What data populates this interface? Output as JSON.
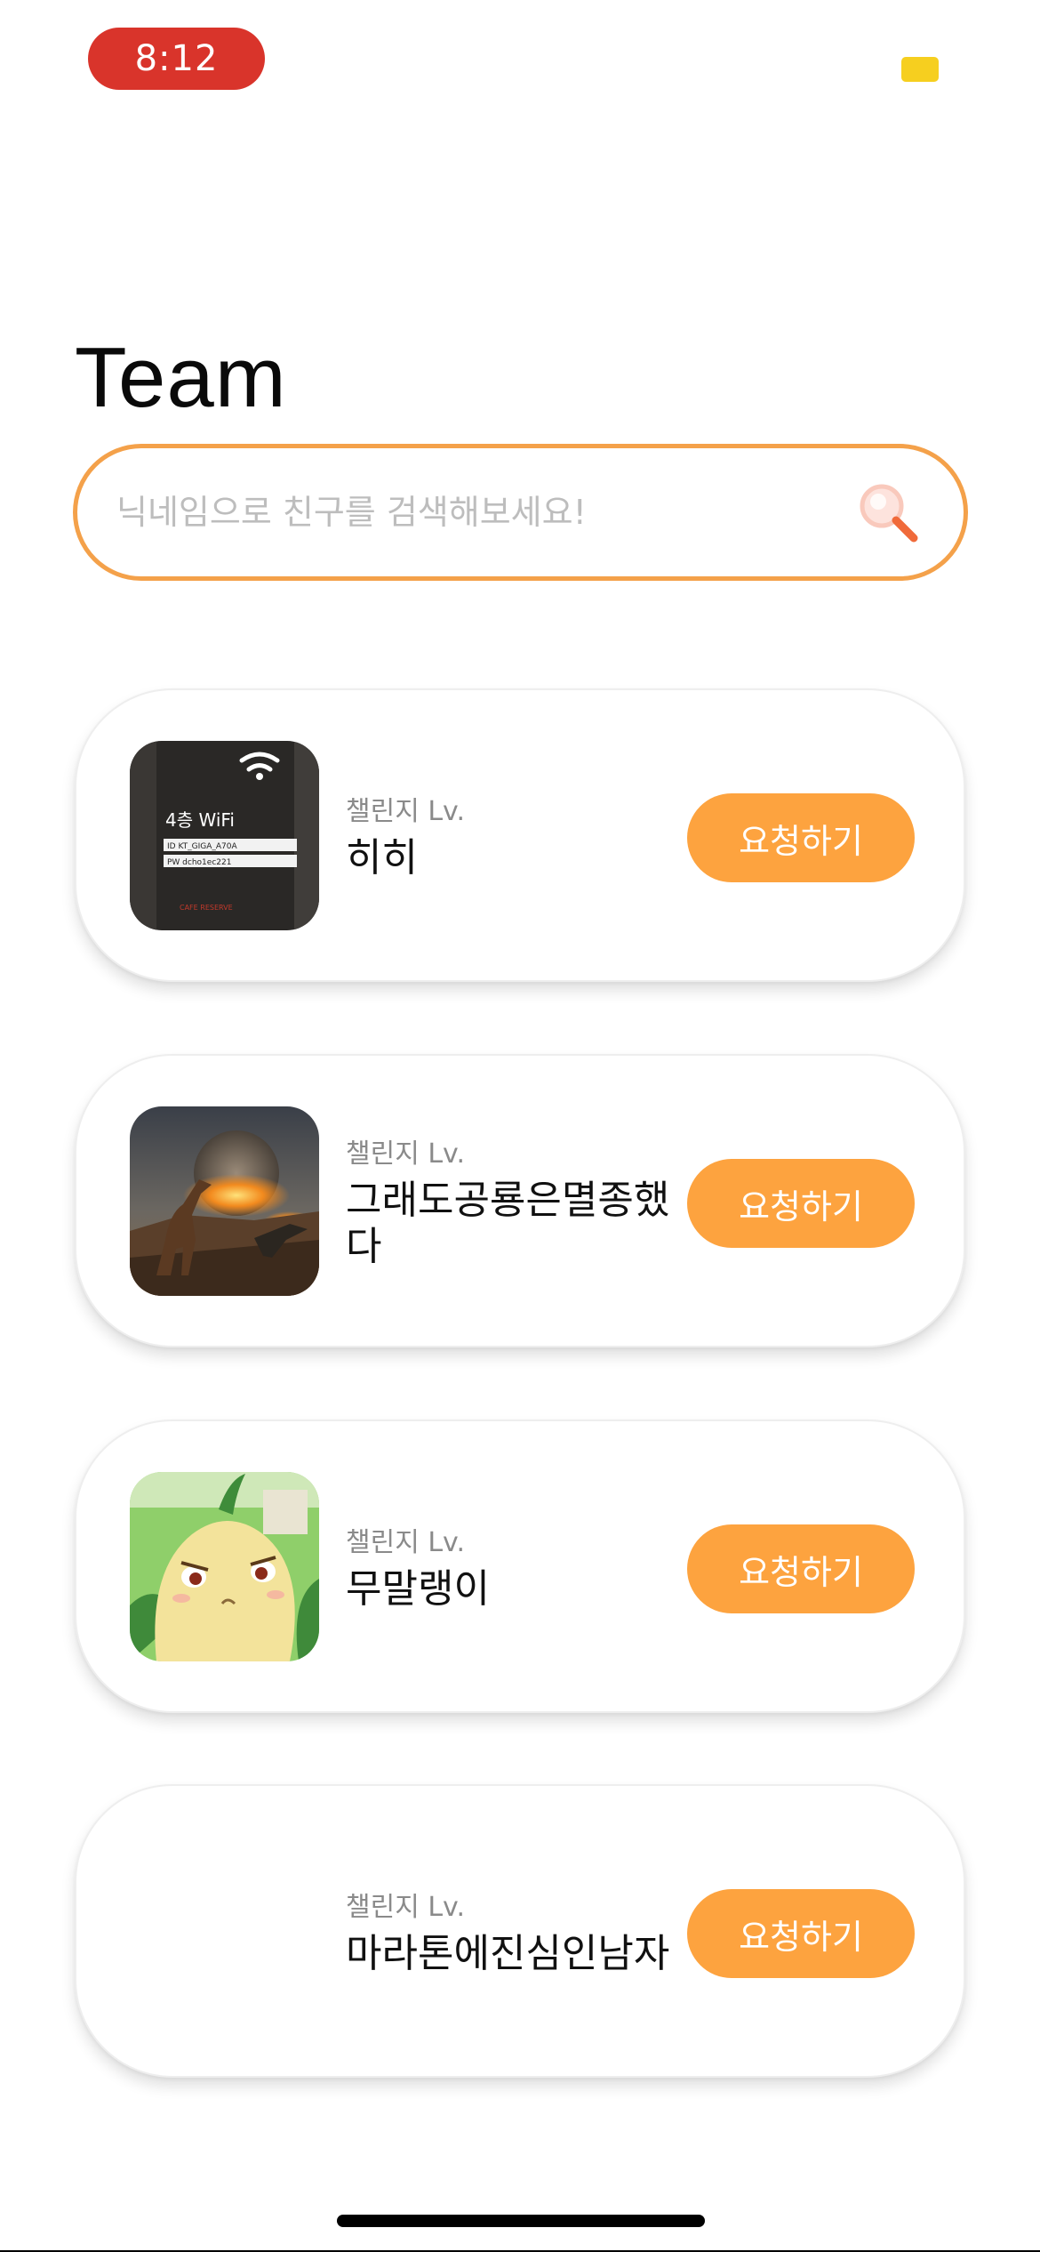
{
  "status_bar": {
    "time": "8:12"
  },
  "page": {
    "title": "Team"
  },
  "search": {
    "placeholder": "닉네임으로 친구를 검색해보세요!",
    "value": "",
    "icon": "search-icon"
  },
  "friends": [
    {
      "level_label": "챌린지 Lv.",
      "name": "히히",
      "avatar": "wifi-sign-photo",
      "avatar_text": {
        "floor": "4층 WiFi",
        "id": "ID KT_GIGA_A70A",
        "pw": "PW dcho1ec221",
        "footer": "CAFE RESERVE"
      },
      "button_label": "요청하기"
    },
    {
      "level_label": "챌린지 Lv.",
      "name": "그래도공룡은멸종했다",
      "avatar": "dinosaur-meteor-photo",
      "button_label": "요청하기"
    },
    {
      "level_label": "챌린지 Lv.",
      "name": "무말랭이",
      "avatar": "leaf-creature-cartoon",
      "button_label": "요청하기"
    },
    {
      "level_label": "챌린지 Lv.",
      "name": "마라톤에진심인남자",
      "avatar": "none",
      "button_label": "요청하기"
    }
  ],
  "colors": {
    "accent": "#fda33f",
    "search_border": "#f4a14a",
    "time_pill": "#d9342b",
    "status_indicator": "#f6cf1f"
  }
}
